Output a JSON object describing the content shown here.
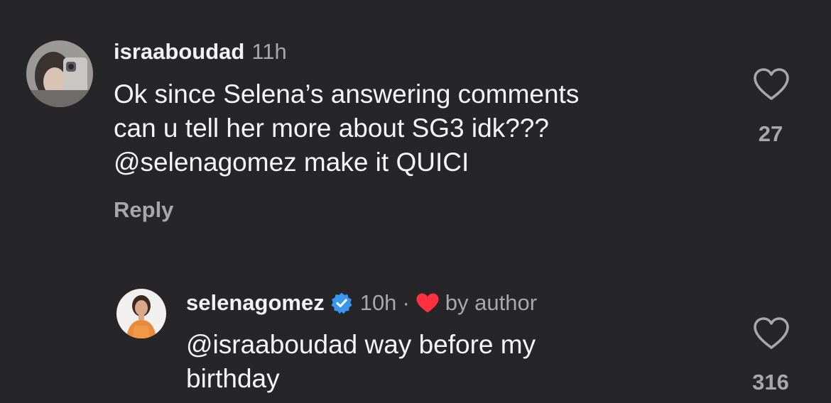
{
  "comment": {
    "username": "israaboudad",
    "time": "11h",
    "text_lines": [
      "Ok since Selena’s answering comments",
      "can u tell her more about SG3 idk???",
      "@selenagomez make it QUICI"
    ],
    "reply_label": "Reply",
    "like_count": "27",
    "avatar_icon": "user-avatar-photo"
  },
  "reply": {
    "username": "selenagomez",
    "verified_icon": "verified-badge-icon",
    "time": "10h",
    "separator": "·",
    "liked_by_author_icon": "heart-icon",
    "by_author": "by author",
    "text_lines": [
      "@israaboudad way before my",
      "birthday"
    ],
    "like_count": "316",
    "avatar_icon": "user-avatar-photo"
  },
  "colors": {
    "background": "#262528",
    "primary_text": "#f5f5f5",
    "secondary_text": "#a8a8a8",
    "verified_blue": "#3897f0",
    "heart_red": "#ff3040"
  }
}
